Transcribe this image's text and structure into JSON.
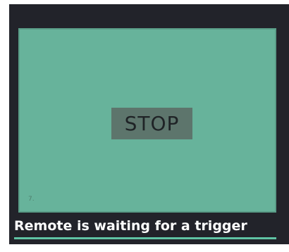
{
  "panel": {
    "button_label": "STOP",
    "corner_mark": "7."
  },
  "status": {
    "message": "Remote is waiting for a trigger"
  },
  "colors": {
    "background": "#22232a",
    "panel": "#67b39b",
    "button": "#5d756c",
    "underline": "#5fc3a4"
  }
}
